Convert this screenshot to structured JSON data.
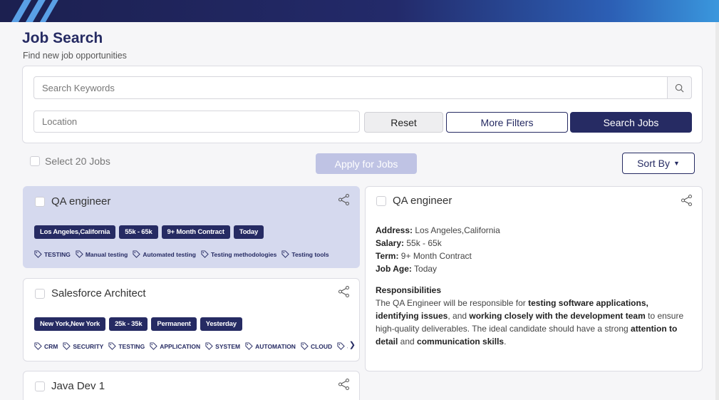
{
  "header": {
    "title": "Job Search",
    "subtitle": "Find new job opportunities"
  },
  "search": {
    "keywords_placeholder": "Search Keywords",
    "location_placeholder": "Location",
    "reset_label": "Reset",
    "more_filters_label": "More Filters",
    "search_label": "Search Jobs"
  },
  "toolbar": {
    "select_label": "Select 20 Jobs",
    "apply_label": "Apply for Jobs",
    "sort_label": "Sort By"
  },
  "jobs": [
    {
      "title": "QA engineer",
      "badges": [
        "Los Angeles,California",
        "55k - 65k",
        "9+ Month Contract",
        "Today"
      ],
      "tags": [
        "TESTING",
        "Manual testing",
        "Automated testing",
        "Testing methodologies",
        "Testing tools"
      ]
    },
    {
      "title": "Salesforce Architect",
      "badges": [
        "New York,New York",
        "25k - 35k",
        "Permanent",
        "Yesterday"
      ],
      "tags": [
        "CRM",
        "SECURITY",
        "TESTING",
        "APPLICATION",
        "SYSTEM",
        "AUTOMATION",
        "CLOUD",
        "J"
      ]
    },
    {
      "title": "Java Dev 1"
    }
  ],
  "detail": {
    "title": "QA engineer",
    "address_label": "Address:",
    "address": "Los Angeles,California",
    "salary_label": "Salary:",
    "salary": "55k - 65k",
    "term_label": "Term:",
    "term": "9+ Month Contract",
    "age_label": "Job Age:",
    "age": "Today",
    "responsibilities_heading": "Responsibilities",
    "resp": {
      "p1": "The QA Engineer will be responsible for ",
      "b1": "testing software applications, identifying issues",
      "p2": ", and ",
      "b2": "working closely with the development team",
      "p3": " to ensure high-quality deliverables. The ideal candidate should have a strong ",
      "b3": "attention to detail",
      "p4": " and ",
      "b4": "communication skills",
      "p5": "."
    }
  },
  "colors": {
    "primary": "#262b63",
    "active_card": "#d5d9ee",
    "apply_disabled": "#bfc3e4"
  },
  "icons": {
    "search": "search-icon",
    "share": "share-icon",
    "tag": "tag-icon"
  }
}
